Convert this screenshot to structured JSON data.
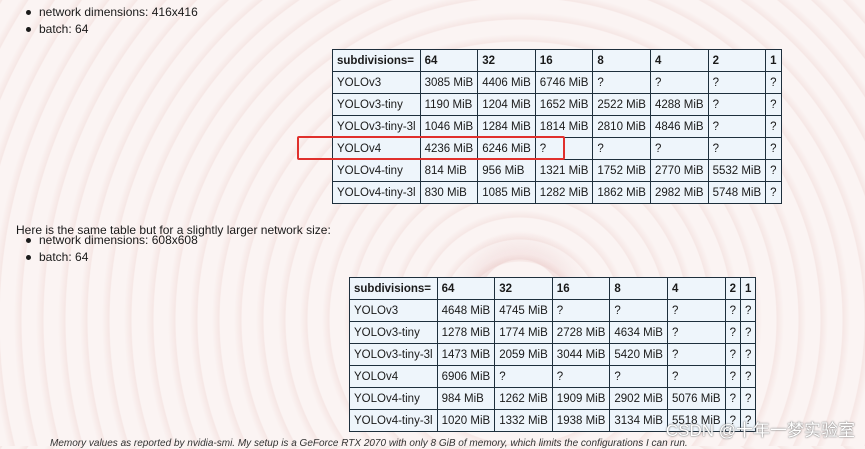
{
  "list1": [
    "network dimensions: 416x416",
    "batch: 64"
  ],
  "table1": {
    "header": [
      "subdivisions=",
      "64",
      "32",
      "16",
      "8",
      "4",
      "2",
      "1"
    ],
    "rows": [
      [
        "YOLOv3",
        "3085 MiB",
        "4406 MiB",
        "6746 MiB",
        "?",
        "?",
        "?",
        "?"
      ],
      [
        "YOLOv3-tiny",
        "1190 MiB",
        "1204 MiB",
        "1652 MiB",
        "2522 MiB",
        "4288 MiB",
        "?",
        "?"
      ],
      [
        "YOLOv3-tiny-3l",
        "1046 MiB",
        "1284 MiB",
        "1814 MiB",
        "2810 MiB",
        "4846 MiB",
        "?",
        "?"
      ],
      [
        "YOLOv4",
        "4236 MiB",
        "6246 MiB",
        "?",
        "?",
        "?",
        "?",
        "?"
      ],
      [
        "YOLOv4-tiny",
        "814 MiB",
        "956 MiB",
        "1321 MiB",
        "1752 MiB",
        "2770 MiB",
        "5532 MiB",
        "?"
      ],
      [
        "YOLOv4-tiny-3l",
        "830 MiB",
        "1085 MiB",
        "1282 MiB",
        "1862 MiB",
        "2982 MiB",
        "5748 MiB",
        "?"
      ]
    ]
  },
  "paragraph": "Here is the same table but for a slightly larger network size:",
  "list2": [
    "network dimensions: 608x608",
    "batch: 64"
  ],
  "table2": {
    "header": [
      "subdivisions=",
      "64",
      "32",
      "16",
      "8",
      "4",
      "2",
      "1"
    ],
    "rows": [
      [
        "YOLOv3",
        "4648 MiB",
        "4745 MiB",
        "?",
        "?",
        "?",
        "?",
        "?"
      ],
      [
        "YOLOv3-tiny",
        "1278 MiB",
        "1774 MiB",
        "2728 MiB",
        "4634 MiB",
        "?",
        "?",
        "?"
      ],
      [
        "YOLOv3-tiny-3l",
        "1473 MiB",
        "2059 MiB",
        "3044 MiB",
        "5420 MiB",
        "?",
        "?",
        "?"
      ],
      [
        "YOLOv4",
        "6906 MiB",
        "?",
        "?",
        "?",
        "?",
        "?",
        "?"
      ],
      [
        "YOLOv4-tiny",
        "984 MiB",
        "1262 MiB",
        "1909 MiB",
        "2902 MiB",
        "5076 MiB",
        "?",
        "?"
      ],
      [
        "YOLOv4-tiny-3l",
        "1020 MiB",
        "1332 MiB",
        "1938 MiB",
        "3134 MiB",
        "5518 MiB",
        "?",
        "?"
      ]
    ]
  },
  "footnote": "Memory values as reported by nvidia-smi. My setup is a GeForce RTX 2070 with only 8 GiB of memory, which limits the configurations I can run.",
  "watermark": "CSDN @十年一梦实验室",
  "colors": {
    "highlight": "#e0302c",
    "table_bg": "#eef5fb",
    "border": "#1e2f3c"
  }
}
